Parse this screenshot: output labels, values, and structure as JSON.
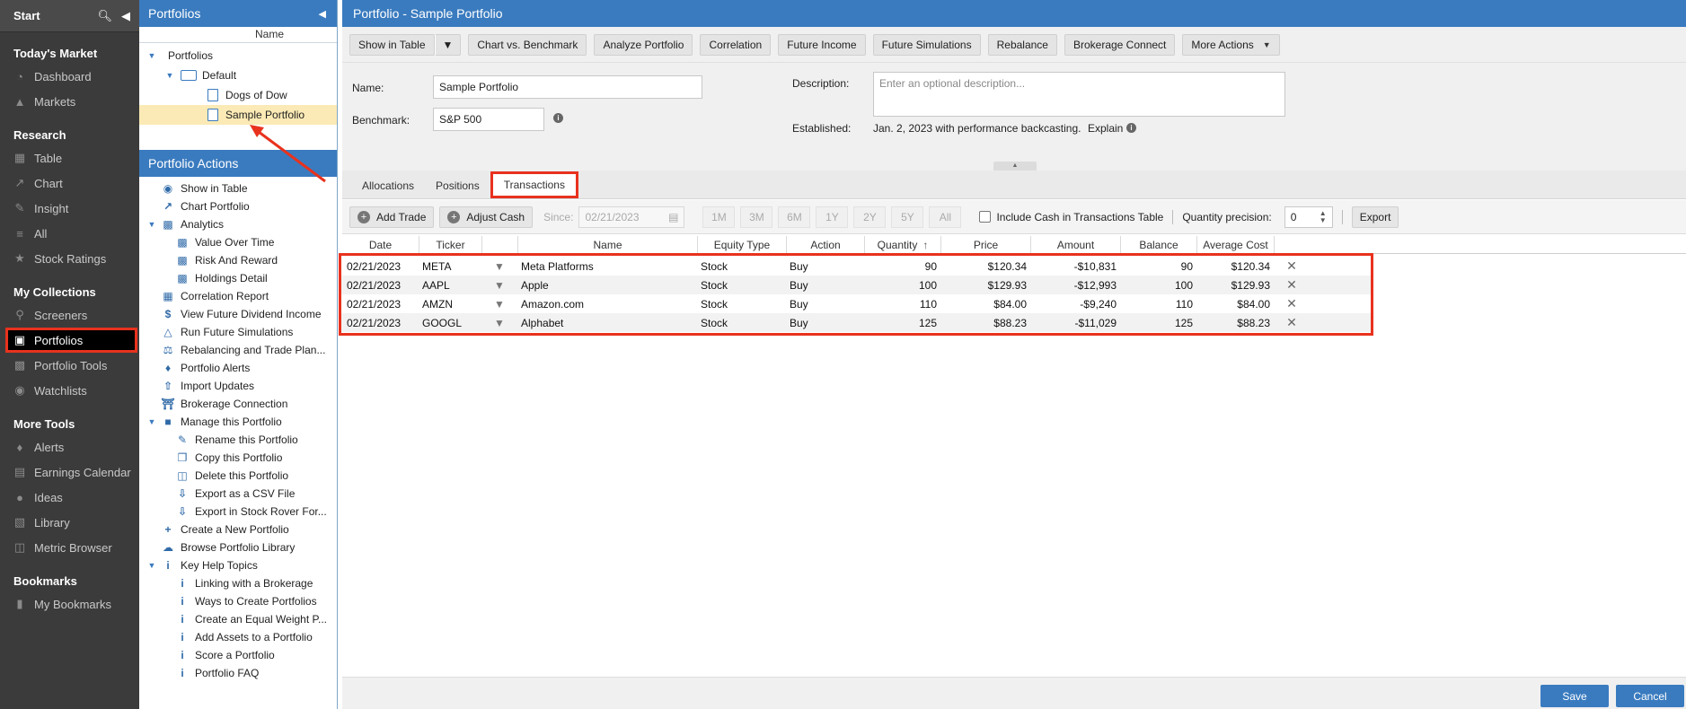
{
  "leftnav": {
    "start_label": "Start",
    "sections": [
      {
        "heading": "Today's Market",
        "items": [
          {
            "label": "Dashboard",
            "icon": "dashboard-icon"
          },
          {
            "label": "Markets",
            "icon": "markets-icon"
          }
        ]
      },
      {
        "heading": "Research",
        "items": [
          {
            "label": "Table",
            "icon": "table-icon"
          },
          {
            "label": "Chart",
            "icon": "chart-icon"
          },
          {
            "label": "Insight",
            "icon": "insight-icon"
          },
          {
            "label": "All",
            "icon": "all-icon"
          },
          {
            "label": "Stock Ratings",
            "icon": "star-icon"
          }
        ]
      },
      {
        "heading": "My Collections",
        "items": [
          {
            "label": "Screeners",
            "icon": "search-icon"
          },
          {
            "label": "Portfolios",
            "icon": "briefcase-icon"
          },
          {
            "label": "Portfolio Tools",
            "icon": "tools-icon"
          },
          {
            "label": "Watchlists",
            "icon": "binoculars-icon"
          }
        ]
      },
      {
        "heading": "More Tools",
        "items": [
          {
            "label": "Alerts",
            "icon": "bell-icon"
          },
          {
            "label": "Earnings Calendar",
            "icon": "calendar-icon"
          },
          {
            "label": "Ideas",
            "icon": "lightbulb-icon"
          },
          {
            "label": "Library",
            "icon": "book-icon"
          },
          {
            "label": "Metric Browser",
            "icon": "metric-icon"
          }
        ]
      },
      {
        "heading": "Bookmarks",
        "items": [
          {
            "label": "My Bookmarks",
            "icon": "bookmark-icon"
          }
        ]
      }
    ]
  },
  "tree": {
    "title": "Portfolios",
    "column": "Name",
    "root": "Portfolios",
    "folder": "Default",
    "items": [
      "Dogs of Dow",
      "Sample Portfolio"
    ]
  },
  "actions": {
    "title": "Portfolio Actions",
    "items": [
      "Show in Table",
      "Chart Portfolio",
      "Analytics",
      "Value Over Time",
      "Risk And Reward",
      "Holdings Detail",
      "Correlation Report",
      "View Future Dividend Income",
      "Run Future Simulations",
      "Rebalancing and Trade Plan...",
      "Portfolio Alerts",
      "Import Updates",
      "Brokerage Connection",
      "Manage this Portfolio",
      "Rename this Portfolio",
      "Copy this Portfolio",
      "Delete this Portfolio",
      "Export as a CSV File",
      "Export in Stock Rover For...",
      "Create a New Portfolio",
      "Browse Portfolio Library",
      "Key Help Topics",
      "Linking with a Brokerage",
      "Ways to Create Portfolios",
      "Create an Equal Weight P...",
      "Add Assets to a Portfolio",
      "Score a Portfolio",
      "Portfolio FAQ"
    ]
  },
  "main": {
    "title": "Portfolio - Sample Portfolio",
    "toolbar": [
      "Show in Table",
      "Chart vs. Benchmark",
      "Analyze Portfolio",
      "Correlation",
      "Future Income",
      "Future Simulations",
      "Rebalance",
      "Brokerage Connect",
      "More Actions"
    ],
    "form": {
      "name_label": "Name:",
      "name_value": "Sample Portfolio",
      "benchmark_label": "Benchmark:",
      "benchmark_value": "S&P 500",
      "description_label": "Description:",
      "description_placeholder": "Enter an optional description...",
      "established_label": "Established:",
      "established_value": "Jan. 2, 2023 with performance backcasting.",
      "explain_label": "Explain"
    },
    "tabs": [
      "Allocations",
      "Positions",
      "Transactions"
    ],
    "active_tab": "Transactions",
    "subbar": {
      "add_trade": "Add Trade",
      "adjust_cash": "Adjust Cash",
      "since_label": "Since:",
      "since_value": "02/21/2023",
      "ranges": [
        "1M",
        "3M",
        "6M",
        "1Y",
        "2Y",
        "5Y",
        "All"
      ],
      "include_cash": "Include Cash in Transactions Table",
      "qty_precision_label": "Quantity precision:",
      "qty_precision_value": "0",
      "export": "Export"
    },
    "columns": [
      "Date",
      "Ticker",
      "",
      "Name",
      "Equity Type",
      "Action",
      "Quantity",
      "Price",
      "Amount",
      "Balance",
      "Average Cost"
    ],
    "rows": [
      [
        "02/21/2023",
        "META",
        "Meta Platforms",
        "Stock",
        "Buy",
        "90",
        "$120.34",
        "-$10,831",
        "90",
        "$120.34"
      ],
      [
        "02/21/2023",
        "AAPL",
        "Apple",
        "Stock",
        "Buy",
        "100",
        "$129.93",
        "-$12,993",
        "100",
        "$129.93"
      ],
      [
        "02/21/2023",
        "AMZN",
        "Amazon.com",
        "Stock",
        "Buy",
        "110",
        "$84.00",
        "-$9,240",
        "110",
        "$84.00"
      ],
      [
        "02/21/2023",
        "GOOGL",
        "Alphabet",
        "Stock",
        "Buy",
        "125",
        "$88.23",
        "-$11,029",
        "125",
        "$88.23"
      ]
    ],
    "save": "Save",
    "cancel": "Cancel"
  },
  "colors": {
    "accent": "#3a7bbf",
    "highlight": "#e8321e",
    "selected": "#fbeab5"
  }
}
